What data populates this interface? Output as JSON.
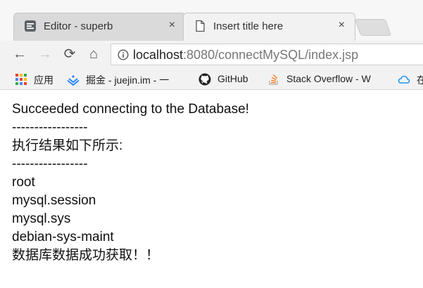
{
  "tabs": [
    {
      "label": "Editor - superb",
      "icon": "editor-icon",
      "active": false
    },
    {
      "label": "Insert title here",
      "icon": "document-icon",
      "active": true
    }
  ],
  "tab_close_glyph": "×",
  "nav": {
    "back": "←",
    "forward": "→",
    "reload": "⟳",
    "home": "⌂"
  },
  "address_bar": {
    "host": "localhost",
    "rest": ":8080/connectMySQL/index.jsp"
  },
  "bookmarks": [
    {
      "label": "应用",
      "icon": "apps-grid-icon"
    },
    {
      "label": "掘金 - juejin.im - 一",
      "icon": "juejin-icon"
    },
    {
      "label": "GitHub",
      "icon": "github-icon"
    },
    {
      "label": "Stack Overflow - W",
      "icon": "stackoverflow-icon"
    },
    {
      "label": "在",
      "icon": "cloud-icon"
    }
  ],
  "page": {
    "lines": [
      "Succeeded connecting to the Database!",
      "-----------------",
      "执行结果如下所示:",
      "-----------------",
      "root",
      "mysql.session",
      "mysql.sys",
      "debian-sys-maint",
      "数据库数据成功获取！！"
    ]
  }
}
